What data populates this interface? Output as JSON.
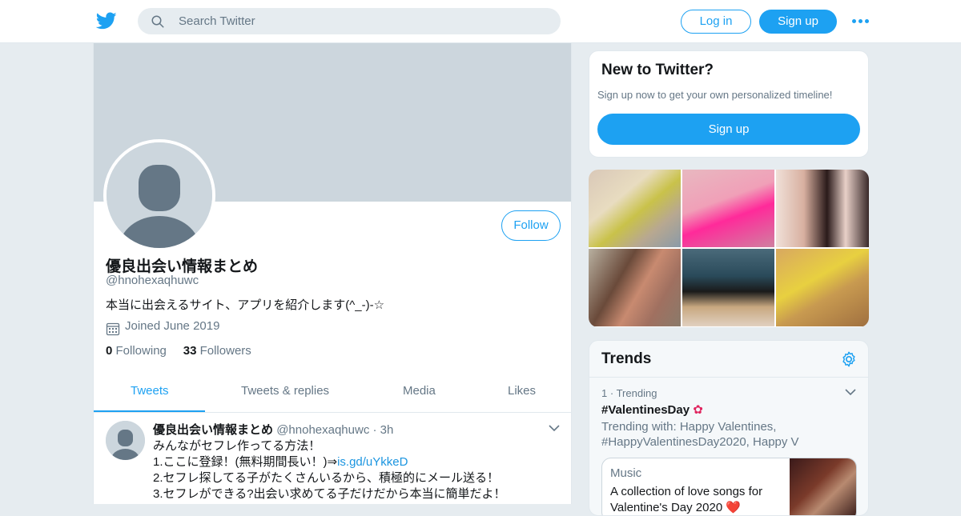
{
  "header": {
    "search_placeholder": "Search Twitter",
    "login_label": "Log in",
    "signup_label": "Sign up",
    "brand_color": "#1da1f2"
  },
  "profile": {
    "name": "優良出会い情報まとめ",
    "handle": "@hnohexaqhuwc",
    "bio": "本当に出会えるサイト、アプリを紹介します(^_-)-☆",
    "joined": "Joined June 2019",
    "following_count": "0",
    "following_label": "Following",
    "followers_count": "33",
    "followers_label": "Followers",
    "follow_label": "Follow"
  },
  "tabs": [
    {
      "label": "Tweets",
      "active": true
    },
    {
      "label": "Tweets & replies",
      "active": false
    },
    {
      "label": "Media",
      "active": false
    },
    {
      "label": "Likes",
      "active": false
    }
  ],
  "tweet": {
    "name": "優良出会い情報まとめ",
    "handle": "@hnohexaqhuwc",
    "dot": "·",
    "time": "3h",
    "line1": "みんながセフレ作ってる方法！",
    "line2_prefix": "1.ここに登録！(無料期間長い！)⇒",
    "line2_link": "is.gd/uYkkeD",
    "line3": "2.セフレ探してる子がたくさんいるから、積極的にメール送る！",
    "line4": "3.セフレができる?出会い求めてる子だけだから本当に簡単だよ！"
  },
  "new_to_twitter": {
    "title": "New to Twitter?",
    "subtitle": "Sign up now to get your own personalized timeline!",
    "button": "Sign up"
  },
  "trends": {
    "title": "Trends",
    "rank": "1",
    "dot": "·",
    "meta": "Trending",
    "name": "#ValentinesDay",
    "with": "Trending with: Happy Valentines, #HappyValentinesDay2020, Happy V",
    "card_category": "Music",
    "card_title": "A collection of love songs for Valentine's Day 2020 ❤️"
  }
}
